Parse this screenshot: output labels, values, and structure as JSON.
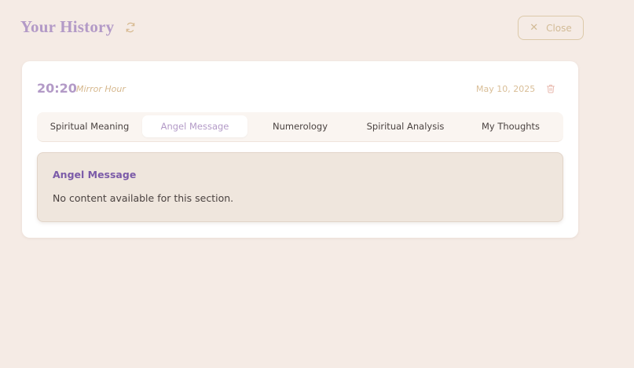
{
  "header": {
    "title": "Your History",
    "close_label": "Close",
    "close_symbol": "✕"
  },
  "entry": {
    "time": "20:20",
    "type": "Mirror Hour",
    "date": "May 10, 2025"
  },
  "tabs": [
    {
      "label": "Spiritual Meaning",
      "active": false
    },
    {
      "label": "Angel Message",
      "active": true
    },
    {
      "label": "Numerology",
      "active": false
    },
    {
      "label": "Spiritual Analysis",
      "active": false
    },
    {
      "label": "My Thoughts",
      "active": false
    }
  ],
  "content": {
    "title": "Angel Message",
    "body": "No content available for this section."
  },
  "colors": {
    "background": "#f5ebe5",
    "accent_lavender": "#b39ac7",
    "accent_gold": "#d6b88e",
    "section_title": "#7b5ba8"
  },
  "icons": {
    "refresh": "refresh-icon",
    "close": "close-icon",
    "trash": "trash-icon"
  }
}
